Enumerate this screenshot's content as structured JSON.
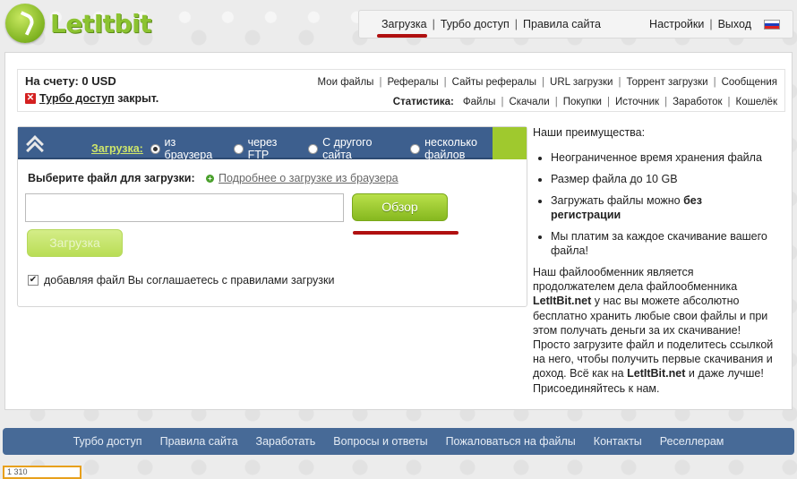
{
  "logo": {
    "text": "LetItbit"
  },
  "topnav": {
    "upload": "Загрузка",
    "turbo": "Турбо доступ",
    "rules": "Правила сайта",
    "settings": "Настройки",
    "logout": "Выход",
    "separator": "|"
  },
  "account": {
    "balance": "На счету: 0 USD",
    "turbo_link": "Турбо доступ",
    "turbo_status": " закрыт.",
    "links": [
      "Мои файлы",
      "Рефералы",
      "Сайты рефералы",
      "URL загрузки",
      "Торрент загрузки",
      "Сообщения"
    ],
    "stats_label": "Статистика:",
    "stats_links": [
      "Файлы",
      "Скачали",
      "Покупки",
      "Источник",
      "Заработок",
      "Кошелёк"
    ]
  },
  "upload": {
    "label": "Загрузка:",
    "options": [
      "из браузера",
      "через FTP",
      "С другого сайта",
      "несколько файлов"
    ],
    "selected_option": "из браузера",
    "choose_file": "Выберите файл для загрузки:",
    "more_link": "Подробнее о загрузке из браузера",
    "file_value": "",
    "browse_button": "Обзор",
    "upload_button": "Загрузка",
    "agree_text": "добавляя файл Вы соглашаетесь с правилами загрузки",
    "agree_checked": true
  },
  "advantages": {
    "title": "Наши преимущества:",
    "items": [
      "Неограниченное время хранения файла",
      "Размер файла до 10 GB",
      "Загружать файлы можно ",
      "Мы платим за каждое скачивание вашего файла!"
    ],
    "item3_bold": "без регистрации"
  },
  "about": {
    "p1": "Наш файлообменник является продолжателем дела файлообменника ",
    "brand1": "LetItBit.net",
    "p2": " у нас вы можете абсолютно бесплатно хранить любые свои файлы и при этом получать деньги за их скачивание! Просто загрузите файл и поделитесь ссылкой на него, чтобы получить первые скачивания и доход. Всё как на ",
    "brand2": "LetItBit.net",
    "p3": " и даже лучше! Присоединяйтесь к нам."
  },
  "footer": {
    "links": [
      "Турбо доступ",
      "Правила сайта",
      "Заработать",
      "Вопросы и ответы",
      "Пожаловаться на файлы",
      "Контакты",
      "Реселлерам"
    ]
  },
  "counter": {
    "text": "1 310"
  },
  "colors": {
    "accent_green": "#8cc331",
    "nav_blue": "#476a97",
    "highlight_red": "#b01010"
  }
}
